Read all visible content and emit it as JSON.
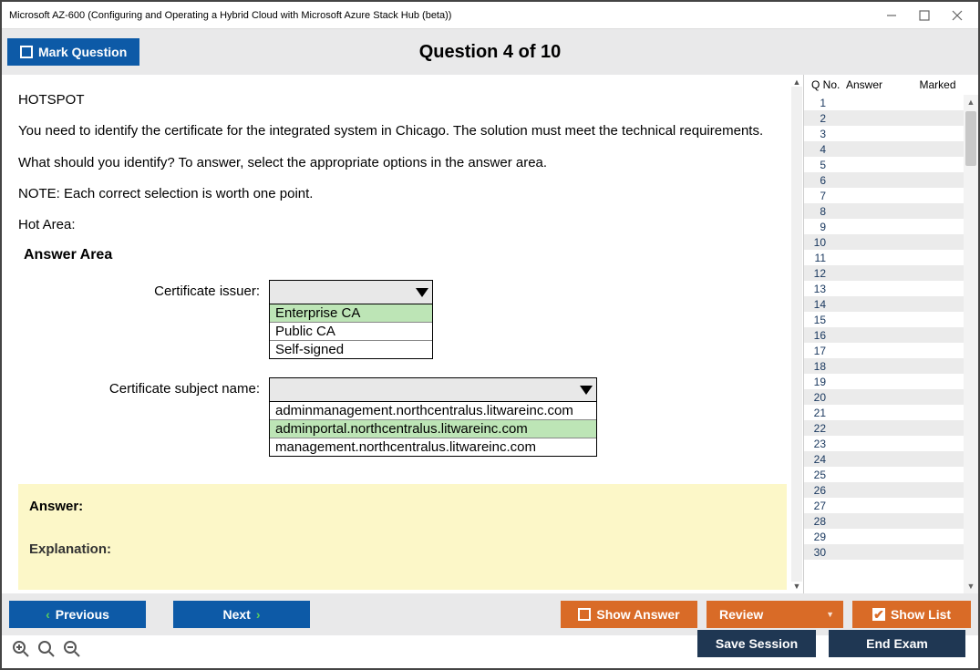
{
  "window": {
    "title": "Microsoft AZ-600 (Configuring and Operating a Hybrid Cloud with Microsoft Azure Stack Hub (beta))"
  },
  "toolbar": {
    "mark_label": "Mark Question",
    "question_title": "Question 4 of 10"
  },
  "question": {
    "tag": "HOTSPOT",
    "p1": "You need to identify the certificate for the integrated system in Chicago. The solution must meet the technical requirements.",
    "p2": "What should you identify? To answer, select the appropriate options in the answer area.",
    "p3": "NOTE: Each correct selection is worth one point.",
    "p4": "Hot Area:",
    "answer_area": "Answer Area",
    "issuer_label": "Certificate issuer:",
    "issuer_options": [
      "Enterprise CA",
      "Public CA",
      "Self-signed"
    ],
    "issuer_selected": 0,
    "subject_label": "Certificate subject name:",
    "subject_options": [
      "adminmanagement.northcentralus.litwareinc.com",
      "adminportal.northcentralus.litwareinc.com",
      "management.northcentralus.litwareinc.com"
    ],
    "subject_selected": 1,
    "answer_label": "Answer:",
    "explanation_label": "Explanation:"
  },
  "sidebar": {
    "h1": "Q No.",
    "h2": "Answer",
    "h3": "Marked",
    "count": 30
  },
  "buttons": {
    "previous": "Previous",
    "next": "Next",
    "show_answer": "Show Answer",
    "review": "Review",
    "show_list": "Show List",
    "save_session": "Save Session",
    "end_exam": "End Exam"
  }
}
